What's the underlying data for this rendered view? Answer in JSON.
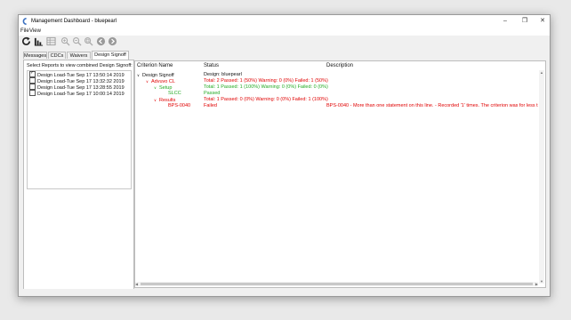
{
  "window": {
    "title": "Management Dashboard - bluepearl"
  },
  "menu": {
    "file": "File",
    "view": "View"
  },
  "tabs": [
    {
      "label": "Messages"
    },
    {
      "label": "CDCs"
    },
    {
      "label": "Waivers"
    },
    {
      "label": "Design Signoff"
    }
  ],
  "left": {
    "hint": "Select Reports to view combined Design Signoff:",
    "reports": [
      {
        "label": "Design Load-Tue Sep 17 13:50:14 2019",
        "checked": true
      },
      {
        "label": "Design Load-Tue Sep 17 13:32:32 2019",
        "checked": false
      },
      {
        "label": "Design Load-Tue Sep 17 13:28:55 2019",
        "checked": false
      },
      {
        "label": "Design Load-Tue Sep 17 10:00:14 2019",
        "checked": false
      }
    ]
  },
  "grid": {
    "headers": {
      "criterion": "Criterion Name",
      "status": "Status",
      "description": "Description"
    },
    "rows": [
      {
        "chevron": "∨",
        "name": "Design Signoff",
        "status": "Design: bluepearl",
        "description": "",
        "color": "#111111"
      },
      {
        "chevron": "∨",
        "name": "Advuvo CL",
        "status": "Total: 2 Passed: 1 (50%) Warning: 0 (0%) Failed: 1 (50%)",
        "description": "",
        "color": "#e00000"
      },
      {
        "chevron": "∨",
        "name": "Setup",
        "status": "Total: 1 Passed: 1 (100%) Warning: 0 (0%) Failed: 0 (0%)",
        "description": "",
        "color": "#22aa22"
      },
      {
        "chevron": "",
        "name": "SLCC",
        "status": "Passed",
        "description": "",
        "color": "#22aa22"
      },
      {
        "chevron": "∨",
        "name": "Results",
        "status": "Total: 1 Passed: 0 (0%) Warning: 0 (0%) Failed: 1 (100%)",
        "description": "",
        "color": "#e00000"
      },
      {
        "chevron": "",
        "name": "BPS-0040",
        "status": "Failed",
        "description": "BPS-0040 - More than one statement on this line. - Recorded '1' times.  The criterion was for less t...",
        "color": "#e00000"
      }
    ]
  },
  "icons": [
    "refresh-icon",
    "chart-icon",
    "grid-icon",
    "zoom-in-icon",
    "zoom-out-icon",
    "zoom-fit-icon",
    "prev-icon",
    "next-icon"
  ]
}
